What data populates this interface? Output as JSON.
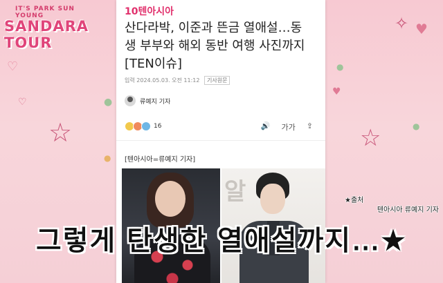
{
  "brand": {
    "small": "IT'S PARK SUN YOUNG",
    "big": "SANDARA TOUR"
  },
  "article": {
    "site_logo": "10텐아시아",
    "headline_line1": "산다라박, 이준과 뜬금 열애설…동",
    "headline_line2": "생 부부와 해외 동반 여행 사진까지",
    "headline_line3": "[TEN이슈]",
    "meta_date": "입력 2024.05.03. 오전 11:12",
    "meta_tag": "기사원문",
    "author": "류예지 기자",
    "reaction_count": "16",
    "tool_audio": "🔊",
    "tool_font": "가가",
    "tool_share": "⇪",
    "caption": "[텐아시아=류예지 기자]"
  },
  "overlay": {
    "source_line1": "★출처",
    "source_line2": "텐아시아 류예지 기자",
    "subtitle": "그렇게 탄생한 열애설까지…★"
  },
  "colors": {
    "accent": "#e1306c",
    "background": "#f7c9d2"
  }
}
